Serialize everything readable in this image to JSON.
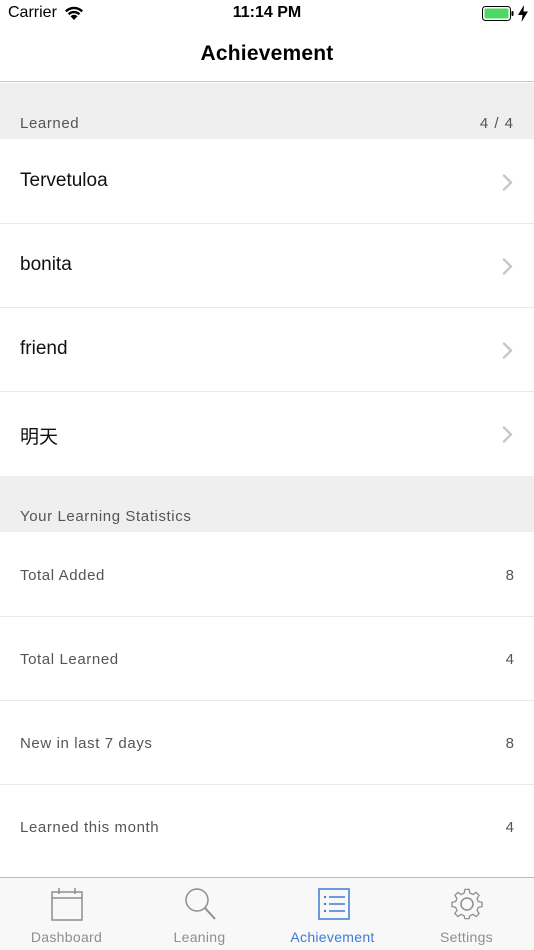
{
  "status_bar": {
    "carrier": "Carrier",
    "time": "11:14 PM"
  },
  "nav": {
    "title": "Achievement"
  },
  "learned_section": {
    "title": "Learned",
    "count": "4 / 4",
    "items": [
      {
        "label": "Tervetuloa"
      },
      {
        "label": "bonita"
      },
      {
        "label": "friend"
      },
      {
        "label": "明天"
      }
    ]
  },
  "stats_section": {
    "title": "Your Learning Statistics",
    "rows": [
      {
        "label": "Total Added",
        "value": "8"
      },
      {
        "label": "Total Learned",
        "value": "4"
      },
      {
        "label": "New in last 7 days",
        "value": "8"
      },
      {
        "label": "Learned this month",
        "value": "4"
      }
    ]
  },
  "tab_bar": {
    "tabs": [
      {
        "label": "Dashboard",
        "icon": "calendar-icon"
      },
      {
        "label": "Leaning",
        "icon": "search-icon"
      },
      {
        "label": "Achievement",
        "icon": "list-icon"
      },
      {
        "label": "Settings",
        "icon": "gear-icon"
      }
    ],
    "active_tab": "Achievement"
  },
  "colors": {
    "accent": "#3d7bd6",
    "battery": "#4cd964",
    "section_bg": "#efefef",
    "inactive_icon": "#8e8e93"
  }
}
